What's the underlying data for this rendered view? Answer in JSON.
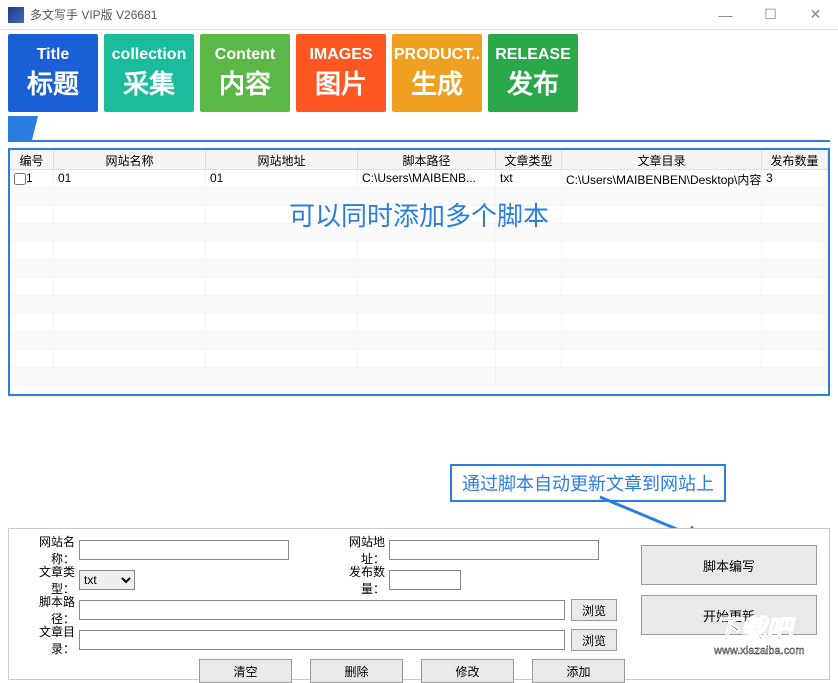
{
  "window": {
    "title": "多文写手 VIP版    V26681"
  },
  "toolbar": [
    {
      "en": "Title",
      "cn": "标题"
    },
    {
      "en": "collection",
      "cn": "采集"
    },
    {
      "en": "Content",
      "cn": "内容"
    },
    {
      "en": "IMAGES",
      "cn": "图片"
    },
    {
      "en": "PRODUCT..",
      "cn": "生成"
    },
    {
      "en": "RELEASE",
      "cn": "发布"
    }
  ],
  "table": {
    "headers": {
      "id": "编号",
      "name": "网站名称",
      "addr": "网站地址",
      "script": "脚本路径",
      "type": "文章类型",
      "dir": "文章目录",
      "count": "发布数量"
    },
    "rows": [
      {
        "id": "1",
        "name": "01",
        "addr": "01",
        "script": "C:\\Users\\MAIBENB...",
        "type": "txt",
        "dir": "C:\\Users\\MAIBENBEN\\Desktop\\内容...",
        "count": "3"
      }
    ],
    "overlay": "可以同时添加多个脚本"
  },
  "annotation": "通过脚本自动更新文章到网站上",
  "form": {
    "labels": {
      "name": "网站名称：",
      "addr": "网站地址：",
      "type": "文章类型：",
      "count": "发布数量：",
      "script": "脚本路径：",
      "dir": "文章目录："
    },
    "type_value": "txt",
    "browse": "浏览",
    "buttons": {
      "clear": "清空",
      "delete": "删除",
      "modify": "修改",
      "add": "添加"
    },
    "right_buttons": {
      "script_edit": "脚本编写",
      "start_update": "开始更新"
    }
  },
  "watermark": {
    "main": "下载吧",
    "url": "www.xiazaiba.com"
  }
}
